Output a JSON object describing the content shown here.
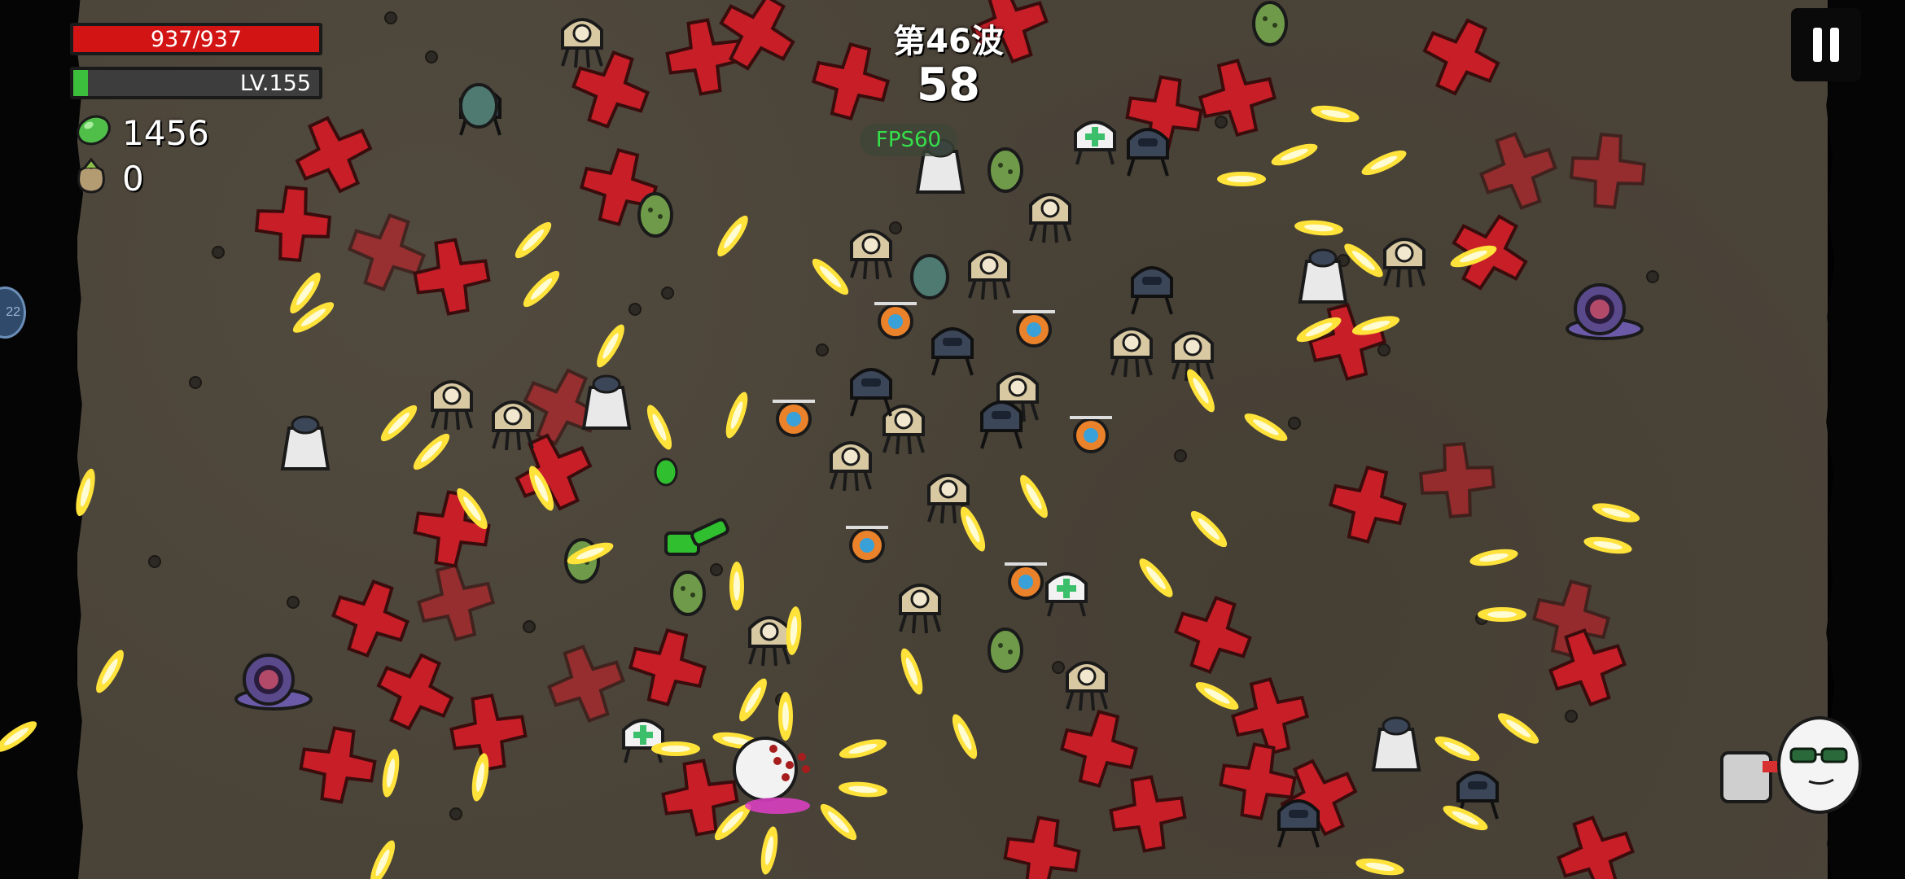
{
  "hud": {
    "hp_text": "937/937",
    "hp_fraction": 1.0,
    "level_text": "LV.155",
    "xp_fraction": 0.06,
    "coins": "1456",
    "bags": "0",
    "wave_label": "第46波",
    "wave_countdown": "58",
    "fps": "FPS60",
    "side_badge": "22"
  },
  "icons": {
    "coin": "green-gem-icon",
    "bag": "loot-bag-icon",
    "pause": "pause-icon"
  },
  "colors": {
    "hp": "#d31414",
    "xp": "#3cbf3c",
    "fps": "#35e04a",
    "ground": "#4a4338",
    "bullet": "#ffe23a",
    "cross": "#c81e28"
  }
}
